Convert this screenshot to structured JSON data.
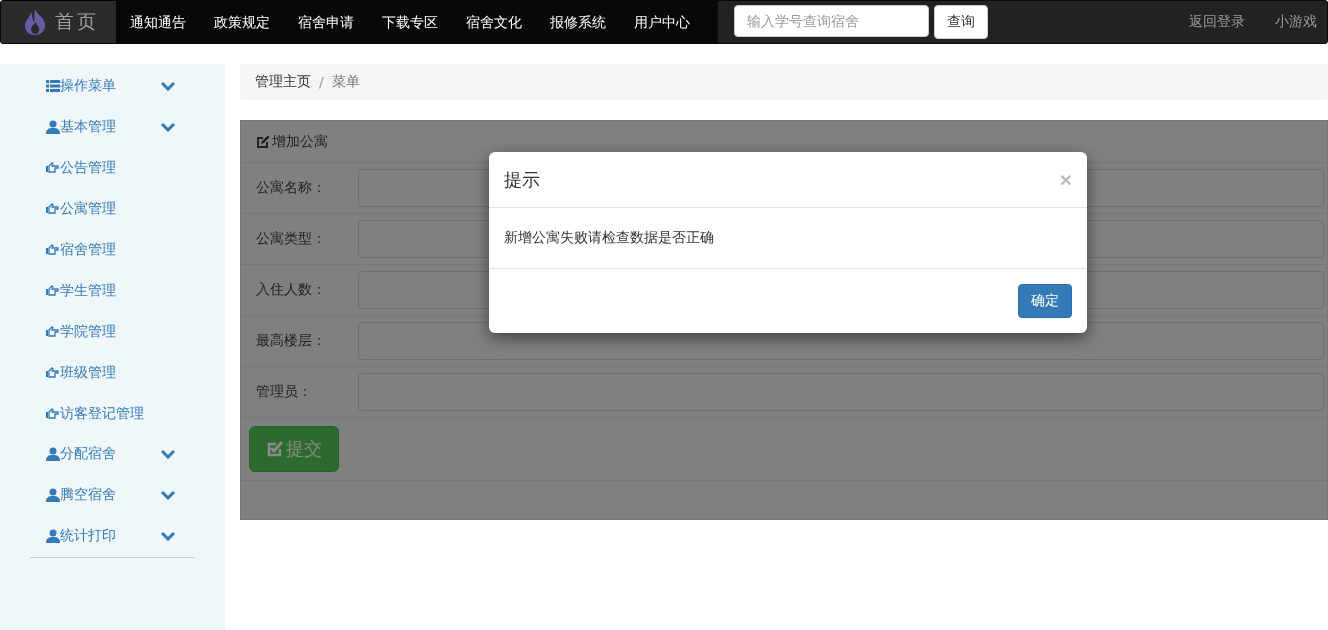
{
  "navbar": {
    "brand": "首页",
    "links": [
      "通知通告",
      "政策规定",
      "宿舍申请",
      "下载专区",
      "宿舍文化",
      "报修系统",
      "用户中心"
    ],
    "search": {
      "placeholder": "输入学号查询宿舍"
    },
    "search_button": "查询",
    "right_links": [
      "返回登录",
      "小游戏"
    ]
  },
  "sidebar": {
    "items": [
      {
        "kind": "menu",
        "label": "操作菜单"
      },
      {
        "kind": "group",
        "label": "基本管理"
      },
      {
        "kind": "link",
        "label": "公告管理"
      },
      {
        "kind": "link",
        "label": "公寓管理"
      },
      {
        "kind": "link",
        "label": "宿舍管理"
      },
      {
        "kind": "link",
        "label": "学生管理"
      },
      {
        "kind": "link",
        "label": "学院管理"
      },
      {
        "kind": "link",
        "label": "班级管理"
      },
      {
        "kind": "link",
        "label": "访客登记管理"
      },
      {
        "kind": "group",
        "label": "分配宿舍"
      },
      {
        "kind": "group",
        "label": "腾空宿舍"
      },
      {
        "kind": "group",
        "label": "统计打印"
      }
    ]
  },
  "breadcrumb": {
    "items": [
      "管理主页",
      "菜单"
    ],
    "separator": "/"
  },
  "form": {
    "title": "增加公寓",
    "fields": [
      {
        "label": "公寓名称："
      },
      {
        "label": "公寓类型："
      },
      {
        "label": "入住人数："
      },
      {
        "label": "最高楼层："
      },
      {
        "label": "管理员："
      }
    ],
    "submit": "提交"
  },
  "modal": {
    "title": "提示",
    "close": "×",
    "message": "新增公寓失败请检查数据是否正确",
    "ok": "确定"
  }
}
